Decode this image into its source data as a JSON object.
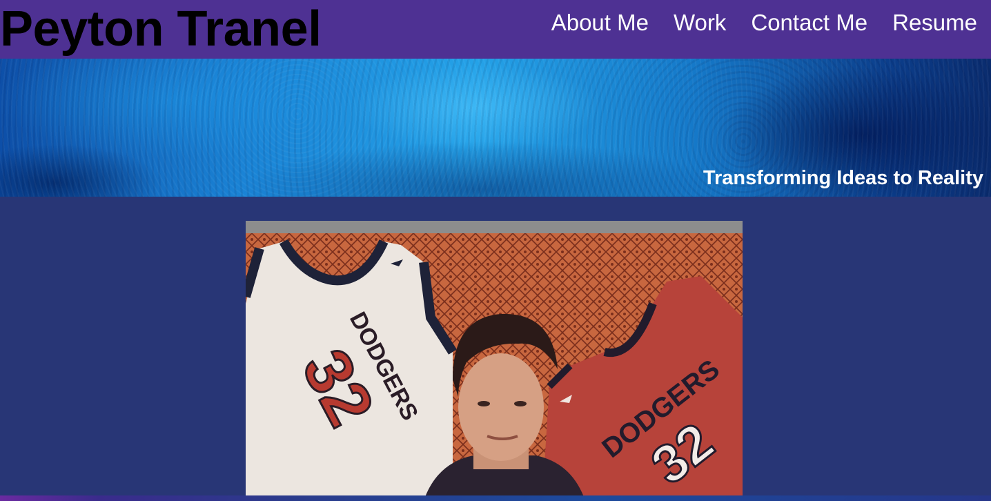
{
  "header": {
    "title": "Peyton Tranel",
    "nav": [
      "About Me",
      "Work",
      "Contact Me",
      "Resume"
    ]
  },
  "hero": {
    "tagline": "Transforming Ideas to Reality"
  },
  "photo": {
    "jersey_text": "DODGERS",
    "jersey_number": "32"
  },
  "colors": {
    "header_bg": "#4e3193",
    "page_bg": "#283676",
    "nav_text": "#ffffff",
    "title_text": "#000000"
  }
}
